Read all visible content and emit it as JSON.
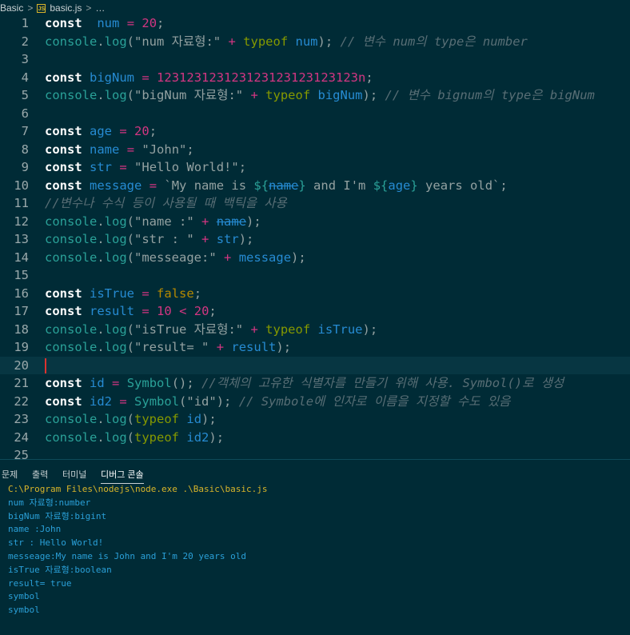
{
  "breadcrumb": {
    "folder": "Basic",
    "file": "basic.js",
    "more": "…",
    "file_icon_label": "JS",
    "file_icon": "javascript-file-icon"
  },
  "editor": {
    "current_line": 20,
    "lines": [
      {
        "n": "1",
        "tokens": [
          [
            "kw",
            "const"
          ],
          [
            "",
            "  "
          ],
          [
            "id",
            "num"
          ],
          [
            "",
            " "
          ],
          [
            "op",
            "="
          ],
          [
            "",
            " "
          ],
          [
            "num",
            "20"
          ],
          [
            "",
            ";"
          ]
        ]
      },
      {
        "n": "2",
        "tokens": [
          [
            "fn",
            "console"
          ],
          [
            "",
            "."
          ],
          [
            "fn",
            "log"
          ],
          [
            "",
            "("
          ],
          [
            "str",
            "\"num 자료형:\""
          ],
          [
            "",
            " "
          ],
          [
            "op",
            "+"
          ],
          [
            "",
            " "
          ],
          [
            "tof",
            "typeof"
          ],
          [
            "",
            " "
          ],
          [
            "id",
            "num"
          ],
          [
            "",
            ");"
          ],
          [
            "",
            " "
          ],
          [
            "cmt",
            "// 변수 num의 type은 number"
          ]
        ]
      },
      {
        "n": "3",
        "tokens": []
      },
      {
        "n": "4",
        "tokens": [
          [
            "kw",
            "const"
          ],
          [
            "",
            " "
          ],
          [
            "id",
            "bigNum"
          ],
          [
            "",
            " "
          ],
          [
            "op",
            "="
          ],
          [
            "",
            " "
          ],
          [
            "num",
            "123123123123123123123123123n"
          ],
          [
            "",
            ";"
          ]
        ]
      },
      {
        "n": "5",
        "tokens": [
          [
            "fn",
            "console"
          ],
          [
            "",
            "."
          ],
          [
            "fn",
            "log"
          ],
          [
            "",
            "("
          ],
          [
            "str",
            "\"bigNum 자료형:\""
          ],
          [
            "",
            " "
          ],
          [
            "op",
            "+"
          ],
          [
            "",
            " "
          ],
          [
            "tof",
            "typeof"
          ],
          [
            "",
            " "
          ],
          [
            "id",
            "bigNum"
          ],
          [
            "",
            ");"
          ],
          [
            "",
            " "
          ],
          [
            "cmt",
            "// 변수 bignum의 type은 bigNum"
          ]
        ]
      },
      {
        "n": "6",
        "tokens": []
      },
      {
        "n": "7",
        "tokens": [
          [
            "kw",
            "const"
          ],
          [
            "",
            " "
          ],
          [
            "id",
            "age"
          ],
          [
            "",
            " "
          ],
          [
            "op",
            "="
          ],
          [
            "",
            " "
          ],
          [
            "num",
            "20"
          ],
          [
            "",
            ";"
          ]
        ]
      },
      {
        "n": "8",
        "tokens": [
          [
            "kw",
            "const"
          ],
          [
            "",
            " "
          ],
          [
            "id",
            "name"
          ],
          [
            "",
            " "
          ],
          [
            "op",
            "="
          ],
          [
            "",
            " "
          ],
          [
            "str",
            "\"John\""
          ],
          [
            "",
            ";"
          ]
        ]
      },
      {
        "n": "9",
        "tokens": [
          [
            "kw",
            "const"
          ],
          [
            "",
            " "
          ],
          [
            "id",
            "str"
          ],
          [
            "",
            " "
          ],
          [
            "op",
            "="
          ],
          [
            "",
            " "
          ],
          [
            "str",
            "\"Hello World!\""
          ],
          [
            "",
            ";"
          ]
        ]
      },
      {
        "n": "10",
        "tokens": [
          [
            "kw",
            "const"
          ],
          [
            "",
            " "
          ],
          [
            "id",
            "message"
          ],
          [
            "",
            " "
          ],
          [
            "op",
            "="
          ],
          [
            "",
            " "
          ],
          [
            "str",
            "`My name is "
          ],
          [
            "tpl",
            "${"
          ],
          [
            "strike",
            "name"
          ],
          [
            "tpl",
            "}"
          ],
          [
            "str",
            " and I'm "
          ],
          [
            "tpl",
            "${"
          ],
          [
            "id",
            "age"
          ],
          [
            "tpl",
            "}"
          ],
          [
            "str",
            " years old`"
          ],
          [
            "",
            ";"
          ]
        ]
      },
      {
        "n": "11",
        "tokens": [
          [
            "cmt",
            "//변수나 수식 등이 사용될 때 백틱을 사용"
          ]
        ]
      },
      {
        "n": "12",
        "tokens": [
          [
            "fn",
            "console"
          ],
          [
            "",
            "."
          ],
          [
            "fn",
            "log"
          ],
          [
            "",
            "("
          ],
          [
            "str",
            "\"name :\""
          ],
          [
            "",
            " "
          ],
          [
            "op",
            "+"
          ],
          [
            "",
            " "
          ],
          [
            "strike",
            "name"
          ],
          [
            "",
            ");"
          ]
        ]
      },
      {
        "n": "13",
        "tokens": [
          [
            "fn",
            "console"
          ],
          [
            "",
            "."
          ],
          [
            "fn",
            "log"
          ],
          [
            "",
            "("
          ],
          [
            "str",
            "\"str : \""
          ],
          [
            "",
            " "
          ],
          [
            "op",
            "+"
          ],
          [
            "",
            " "
          ],
          [
            "id",
            "str"
          ],
          [
            "",
            ");"
          ]
        ]
      },
      {
        "n": "14",
        "tokens": [
          [
            "fn",
            "console"
          ],
          [
            "",
            "."
          ],
          [
            "fn",
            "log"
          ],
          [
            "",
            "("
          ],
          [
            "str",
            "\"messeage:\""
          ],
          [
            "",
            " "
          ],
          [
            "op",
            "+"
          ],
          [
            "",
            " "
          ],
          [
            "id",
            "message"
          ],
          [
            "",
            ");"
          ]
        ]
      },
      {
        "n": "15",
        "tokens": []
      },
      {
        "n": "16",
        "tokens": [
          [
            "kw",
            "const"
          ],
          [
            "",
            " "
          ],
          [
            "id",
            "isTrue"
          ],
          [
            "",
            " "
          ],
          [
            "op",
            "="
          ],
          [
            "",
            " "
          ],
          [
            "bool",
            "false"
          ],
          [
            "",
            ";"
          ]
        ]
      },
      {
        "n": "17",
        "tokens": [
          [
            "kw",
            "const"
          ],
          [
            "",
            " "
          ],
          [
            "id",
            "result"
          ],
          [
            "",
            " "
          ],
          [
            "op",
            "="
          ],
          [
            "",
            " "
          ],
          [
            "num",
            "10"
          ],
          [
            "",
            " "
          ],
          [
            "op",
            "<"
          ],
          [
            "",
            " "
          ],
          [
            "num",
            "20"
          ],
          [
            "",
            ";"
          ]
        ]
      },
      {
        "n": "18",
        "tokens": [
          [
            "fn",
            "console"
          ],
          [
            "",
            "."
          ],
          [
            "fn",
            "log"
          ],
          [
            "",
            "("
          ],
          [
            "str",
            "\"isTrue 자료형:\""
          ],
          [
            "",
            " "
          ],
          [
            "op",
            "+"
          ],
          [
            "",
            " "
          ],
          [
            "tof",
            "typeof"
          ],
          [
            "",
            " "
          ],
          [
            "id",
            "isTrue"
          ],
          [
            "",
            ");"
          ]
        ]
      },
      {
        "n": "19",
        "tokens": [
          [
            "fn",
            "console"
          ],
          [
            "",
            "."
          ],
          [
            "fn",
            "log"
          ],
          [
            "",
            "("
          ],
          [
            "str",
            "\"result= \""
          ],
          [
            "",
            " "
          ],
          [
            "op",
            "+"
          ],
          [
            "",
            " "
          ],
          [
            "id",
            "result"
          ],
          [
            "",
            ");"
          ]
        ]
      },
      {
        "n": "20",
        "tokens": []
      },
      {
        "n": "21",
        "tokens": [
          [
            "kw",
            "const"
          ],
          [
            "",
            " "
          ],
          [
            "id",
            "id"
          ],
          [
            "",
            " "
          ],
          [
            "op",
            "="
          ],
          [
            "",
            " "
          ],
          [
            "fn",
            "Symbol"
          ],
          [
            "",
            "();"
          ],
          [
            "",
            " "
          ],
          [
            "cmt",
            "//객체의 고유한 식별자를 만들기 위해 사용. Symbol()로 생성"
          ]
        ]
      },
      {
        "n": "22",
        "tokens": [
          [
            "kw",
            "const"
          ],
          [
            "",
            " "
          ],
          [
            "id",
            "id2"
          ],
          [
            "",
            " "
          ],
          [
            "op",
            "="
          ],
          [
            "",
            " "
          ],
          [
            "fn",
            "Symbol"
          ],
          [
            "",
            "("
          ],
          [
            "str",
            "\"id\""
          ],
          [
            "",
            ");"
          ],
          [
            "",
            " "
          ],
          [
            "cmt",
            "// Symbole에 인자로 이름을 지정할 수도 있음"
          ]
        ]
      },
      {
        "n": "23",
        "tokens": [
          [
            "fn",
            "console"
          ],
          [
            "",
            "."
          ],
          [
            "fn",
            "log"
          ],
          [
            "",
            "("
          ],
          [
            "tof",
            "typeof"
          ],
          [
            "",
            " "
          ],
          [
            "id",
            "id"
          ],
          [
            "",
            ");"
          ]
        ]
      },
      {
        "n": "24",
        "tokens": [
          [
            "fn",
            "console"
          ],
          [
            "",
            "."
          ],
          [
            "fn",
            "log"
          ],
          [
            "",
            "("
          ],
          [
            "tof",
            "typeof"
          ],
          [
            "",
            " "
          ],
          [
            "id",
            "id2"
          ],
          [
            "",
            ");"
          ]
        ]
      },
      {
        "n": "25",
        "tokens": []
      }
    ]
  },
  "panel": {
    "tabs": [
      "문제",
      "출력",
      "터미널",
      "디버그 콘솔"
    ],
    "active_tab": 3
  },
  "console": {
    "command": "C:\\Program Files\\nodejs\\node.exe .\\Basic\\basic.js",
    "output": [
      "num 자료형:number",
      "bigNum 자료형:bigint",
      "name :John",
      "str : Hello World!",
      "messeage:My name is John and I'm 20 years old",
      "isTrue 자료형:boolean",
      "result= true",
      "symbol",
      "symbol"
    ]
  },
  "colors": {
    "background": "#002b36",
    "keyword": "#ffffff",
    "function": "#2aa198",
    "identifier": "#268bd2",
    "operator": "#d33682",
    "comment": "#586e75",
    "console_output": "#2aa0d8",
    "console_command": "#d8b52a"
  }
}
